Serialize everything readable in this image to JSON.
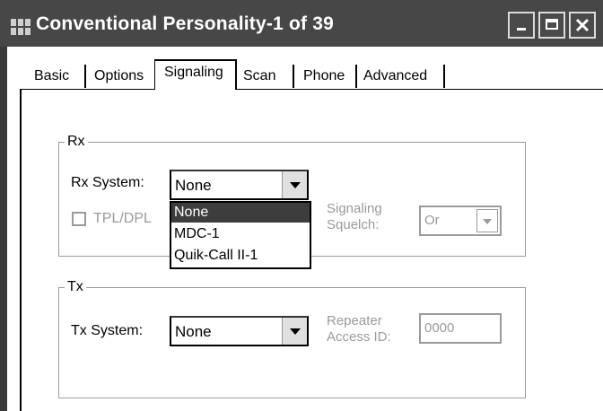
{
  "window": {
    "title": "Conventional Personality-1 of 39",
    "buttons": {
      "minimize": "minimize-icon",
      "maximize": "maximize-icon",
      "close": "close-icon"
    }
  },
  "tabs": [
    {
      "label": "Basic",
      "active": false
    },
    {
      "label": "Options",
      "active": false
    },
    {
      "label": "Signaling",
      "active": true
    },
    {
      "label": "Scan",
      "active": false
    },
    {
      "label": "Phone",
      "active": false
    },
    {
      "label": "Advanced",
      "active": false
    }
  ],
  "rx": {
    "group_label": "Rx",
    "system_label": "Rx System:",
    "system_value": "None",
    "tpl_label": "TPL/DPL",
    "tpl_checked": false,
    "squelch_label_line1": "Signaling",
    "squelch_label_line2": "Squelch:",
    "squelch_value": "Or",
    "dropdown_options": [
      "None",
      "MDC-1",
      "Quik-Call II-1"
    ],
    "dropdown_selected": "None"
  },
  "tx": {
    "group_label": "Tx",
    "system_label": "Tx System:",
    "system_value": "None",
    "repeater_label_line1": "Repeater",
    "repeater_label_line2": "Access ID:",
    "repeater_value": "0000"
  }
}
